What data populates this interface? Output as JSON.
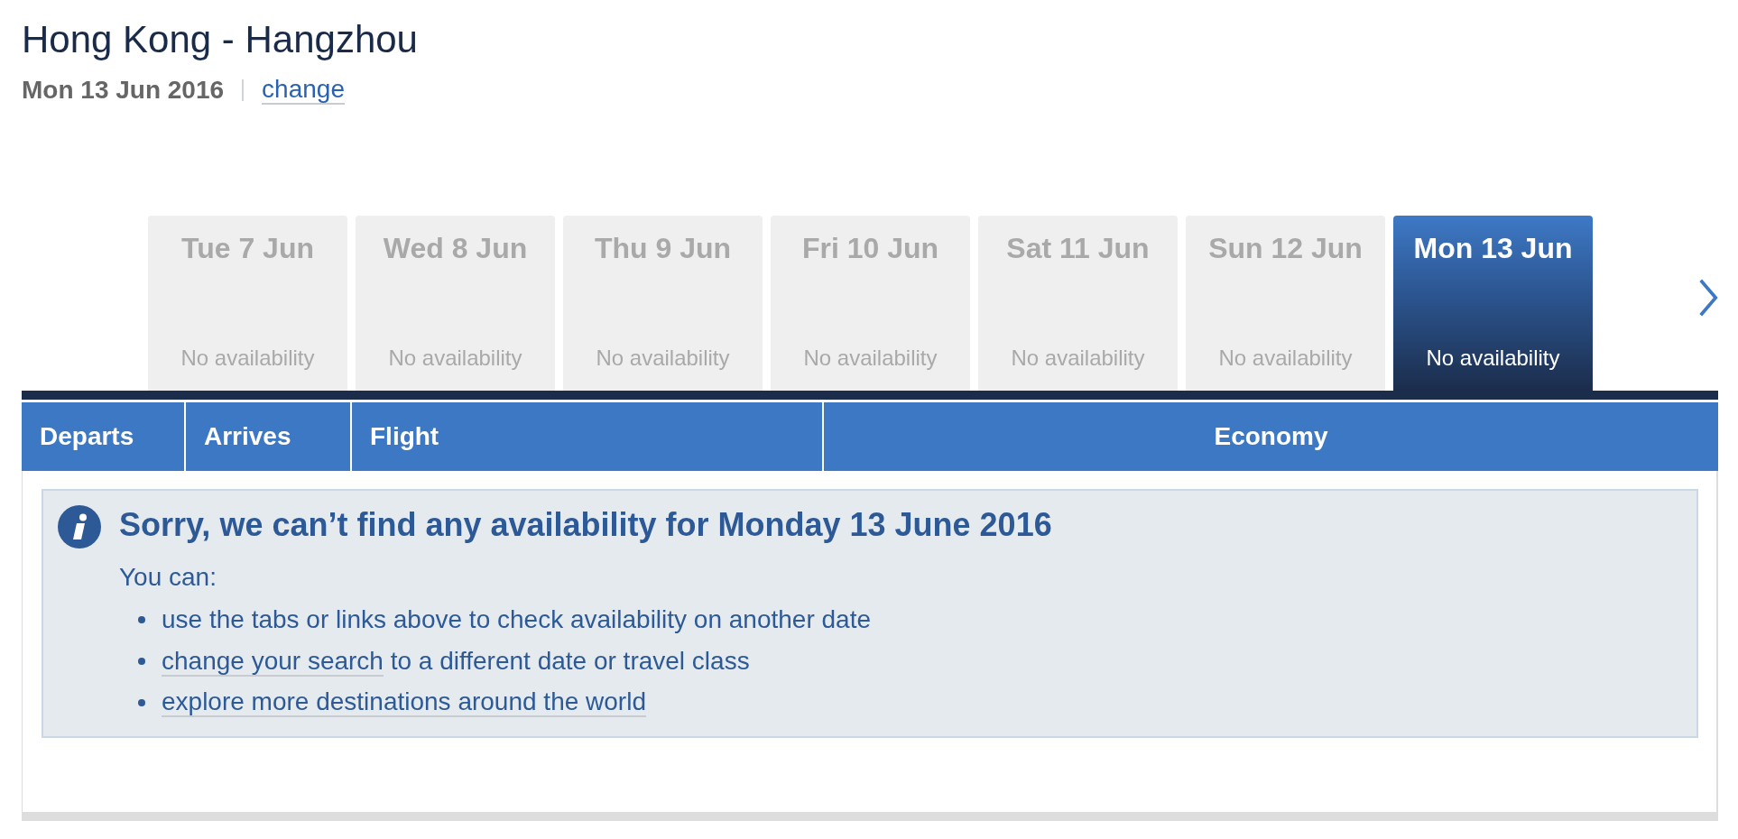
{
  "route": {
    "title": "Hong Kong - Hangzhou",
    "date": "Mon 13 Jun 2016",
    "change_link": "change"
  },
  "date_tabs": [
    {
      "label": "Tue 7 Jun",
      "status": "No availability",
      "selected": false
    },
    {
      "label": "Wed 8 Jun",
      "status": "No availability",
      "selected": false
    },
    {
      "label": "Thu 9 Jun",
      "status": "No availability",
      "selected": false
    },
    {
      "label": "Fri 10 Jun",
      "status": "No availability",
      "selected": false
    },
    {
      "label": "Sat 11 Jun",
      "status": "No availability",
      "selected": false
    },
    {
      "label": "Sun 12 Jun",
      "status": "No availability",
      "selected": false
    },
    {
      "label": "Mon 13 Jun",
      "status": "No availability",
      "selected": true
    }
  ],
  "table": {
    "columns": [
      "Departs",
      "Arrives",
      "Flight",
      "Economy"
    ]
  },
  "message": {
    "heading": "Sorry, we can’t find any availability for Monday 13 June 2016",
    "intro": "You can:",
    "items": [
      {
        "text": "use the tabs or links above to check availability on another date"
      },
      {
        "link": "change your search",
        "text": "to a different date or travel class"
      },
      {
        "link": "explore more destinations around the world"
      }
    ]
  }
}
